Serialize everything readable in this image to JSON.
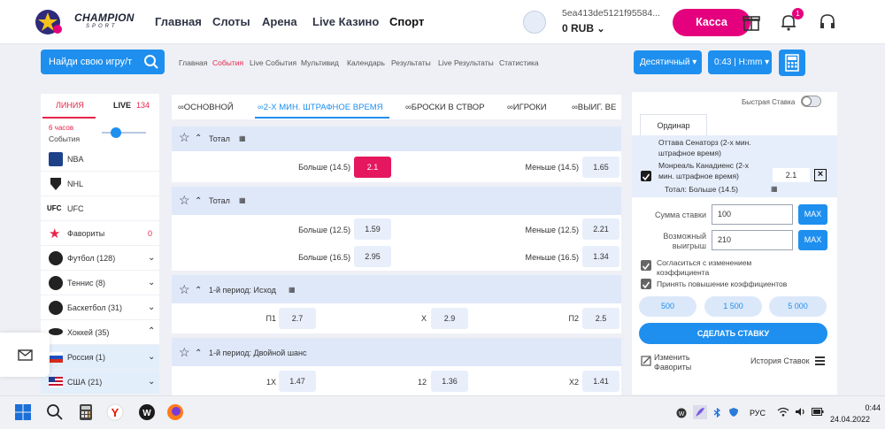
{
  "header": {
    "logo_text": "CHAMPION",
    "logo_sub": "SPORT",
    "nav": [
      "Главная",
      "Слоты",
      "Арена",
      "Live Казино",
      "Спорт"
    ],
    "user_id": "5ea413de5121f95584...",
    "balance": "0 RUB",
    "kassa": "Касса",
    "notif_count": "1"
  },
  "toolbar": {
    "search_placeholder": "Найди свою игру/т",
    "links": [
      "Главная",
      "События",
      "Live События",
      "Мультивид",
      "Календарь",
      "Результаты",
      "Live Результаты",
      "Статистика"
    ],
    "odds_format": "Десятичный",
    "time_format": "0:43 | H:mm"
  },
  "left": {
    "tab_line": "ЛИНИЯ",
    "tab_live": "LIVE",
    "live_count": "134",
    "hours": "6 часов",
    "events_label": "События",
    "sports": [
      {
        "label": "NBA",
        "icon": "nba-icon"
      },
      {
        "label": "NHL",
        "icon": "nhl-icon"
      },
      {
        "label": "UFC",
        "icon": "ufc-icon"
      },
      {
        "label": "Фавориты",
        "count": "0",
        "icon": "star-icon"
      },
      {
        "label": "Футбол (128)",
        "icon": "football-icon"
      },
      {
        "label": "Теннис (8)",
        "icon": "tennis-icon"
      },
      {
        "label": "Баскетбол (31)",
        "icon": "basketball-icon"
      },
      {
        "label": "Хоккей (35)",
        "icon": "hockey-icon"
      },
      {
        "label": "Россия (1)",
        "icon": "flag-russia-icon"
      },
      {
        "label": "США (21)",
        "icon": "flag-usa-icon"
      }
    ]
  },
  "market_tabs": [
    "ОСНОВНОЙ",
    "2-Х МИН. ШТРАФНОЕ ВРЕМЯ",
    "БРОСКИ В СТВОР",
    "ИГРОКИ",
    "ВЫИГ. ВЕ"
  ],
  "markets": [
    {
      "title": "Тотал",
      "rows": [
        {
          "l1": "Больше (14.5)",
          "v1": "2.1",
          "l2": "Меньше (14.5)",
          "v2": "1.65"
        }
      ]
    },
    {
      "title": "Тотал",
      "rows": [
        {
          "l1": "Больше (12.5)",
          "v1": "1.59",
          "l2": "Меньше (12.5)",
          "v2": "2.21"
        },
        {
          "l1": "Больше (16.5)",
          "v1": "2.95",
          "l2": "Меньше (16.5)",
          "v2": "1.34"
        }
      ]
    },
    {
      "title": "1-й период: Исход",
      "rows": [
        {
          "l1": "П1",
          "v1": "2.7",
          "l2": "Х",
          "v2": "2.9",
          "l3": "П2",
          "v3": "2.5"
        }
      ]
    },
    {
      "title": "1-й период: Двойной шанс",
      "rows": [
        {
          "l1": "1X",
          "v1": "1.47",
          "l2": "12",
          "v2": "1.36",
          "l3": "X2",
          "v3": "1.41"
        }
      ]
    }
  ],
  "betslip": {
    "quick_bet": "Быстрая Ставка",
    "tab": "Ординар",
    "event1": "Оттава Сенаторз (2-х мин. штрафное время)",
    "event1_a": "Оттава Сенаторз (2-х мин.",
    "event1_b": "штрафное время)",
    "event2_a": "Монреаль Канадиенс (2-х",
    "event2_b": "мин. штрафное время)",
    "market": "Тотал: Больше (14.5)",
    "odds": "2.1",
    "stake_label": "Сумма ставки",
    "stake": "100",
    "win_label_a": "Возможный",
    "win_label_b": "выигрыш",
    "win": "210",
    "max": "MAX",
    "cb1_a": "Согласиться с изменением",
    "cb1_b": "коэффициента",
    "cb2": "Принять повышение коэффициентов",
    "amounts": [
      "500",
      "1 500",
      "5 000"
    ],
    "make_bet": "СДЕЛАТЬ СТАВКУ",
    "edit_fav_a": "Изменить",
    "edit_fav_b": "Фавориты",
    "history": "История Ставок"
  },
  "taskbar": {
    "lang": "РУС",
    "time": "0:44",
    "date": "24.04.2022"
  }
}
